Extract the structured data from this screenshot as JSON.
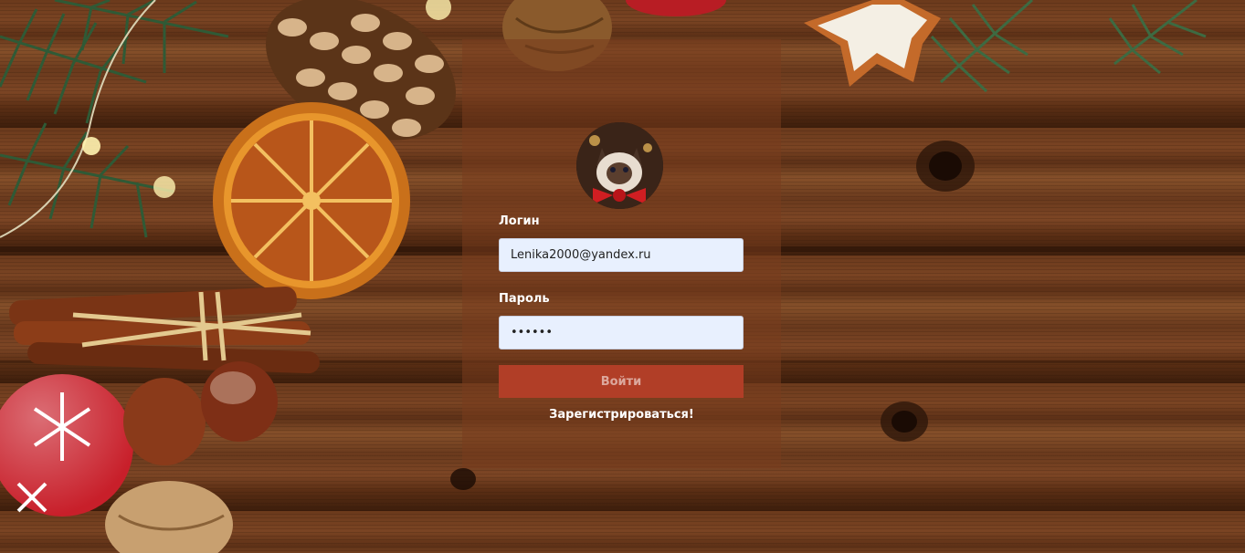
{
  "form": {
    "login_label": "Логин",
    "login_value": "Lenika2000@yandex.ru",
    "password_label": "Пароль",
    "password_value": "123456",
    "submit_label": "Войти",
    "register_label": "Зарегистрироваться!"
  },
  "avatar": {
    "icon": "cat-avatar-icon"
  },
  "colors": {
    "panel_overlay": "#7a3c1e",
    "input_background": "#e8f0fe",
    "button_background": "#b13e27",
    "wood_dark": "#5e3117",
    "wood_light": "#86502a"
  }
}
